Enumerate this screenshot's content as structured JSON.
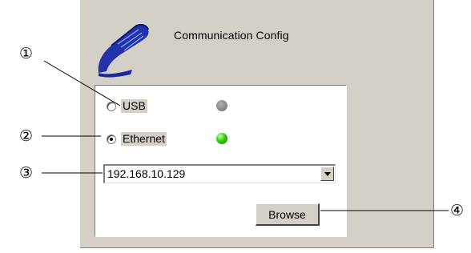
{
  "window": {
    "title": "Communication Config"
  },
  "connection": {
    "options": [
      {
        "label": "USB",
        "selected": false,
        "status": "inactive",
        "status_color": "#8a8a8a"
      },
      {
        "label": "Ethernet",
        "selected": true,
        "status": "active",
        "status_color": "#30d000"
      }
    ],
    "address": {
      "value": "192.168.10.129"
    },
    "browse_label": "Browse"
  },
  "callouts": [
    "①",
    "②",
    "③",
    "④"
  ],
  "icons": {
    "logo": "usb-cable-logo-icon",
    "dropdown": "chevron-down-icon"
  }
}
